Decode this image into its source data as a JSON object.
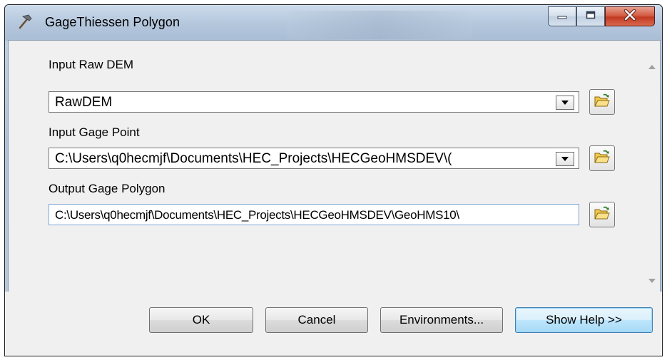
{
  "window": {
    "title": "GageThiessen Polygon",
    "app_icon": "hammer-icon",
    "caption_buttons": {
      "minimize": "minimize-icon",
      "maximize": "maximize-icon",
      "close": "close-icon"
    }
  },
  "form": {
    "raw_dem": {
      "label": "Input Raw DEM",
      "value": "RawDEM"
    },
    "gage_point": {
      "label": "Input Gage Point",
      "value": "C:\\Users\\q0hecmjf\\Documents\\HEC_Projects\\HECGeoHMSDEV\\("
    },
    "gage_polygon": {
      "label": "Output Gage Polygon",
      "value": "C:\\Users\\q0hecmjf\\Documents\\HEC_Projects\\HECGeoHMSDEV\\GeoHMS10\\"
    },
    "browse_icon": "folder-open-icon"
  },
  "buttons": {
    "ok": "OK",
    "cancel": "Cancel",
    "environments": "Environments...",
    "show_help": "Show Help >>"
  },
  "colors": {
    "close_button": "#c9452c",
    "folder_icon": "#f2c94c",
    "focused_border": "#7fa6d6"
  }
}
